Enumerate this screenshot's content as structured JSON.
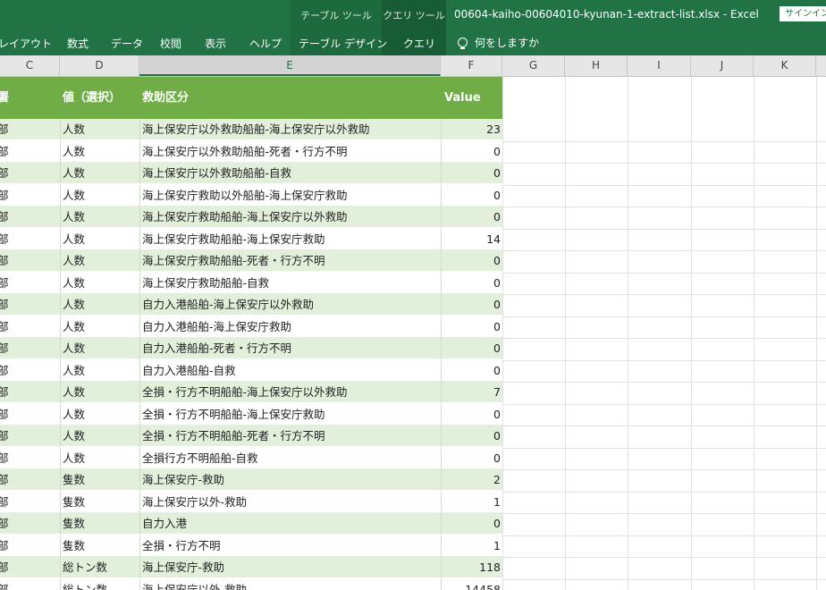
{
  "ribbon": {
    "context_table": "テーブル ツール",
    "context_query": "クエリ ツール",
    "file_title": "00604-kaiho-00604010-kyunan-1-extract-list.xlsx  -  Excel",
    "signin": "サインイン",
    "tabs": [
      "レイアウト",
      "数式",
      "データ",
      "校閲",
      "表示",
      "ヘルプ",
      "テーブル デザイン",
      "クエリ"
    ],
    "tell_me": "何をしますか"
  },
  "columns": [
    "C",
    "D",
    "E",
    "F",
    "G",
    "H",
    "I",
    "J",
    "K"
  ],
  "table": {
    "headers": [
      "署",
      "値（選択）",
      "救助区分",
      "Value"
    ],
    "rows": [
      {
        "c": "部",
        "d": "人数",
        "e": "海上保安庁以外救助船舶-海上保安庁以外救助",
        "f": "23"
      },
      {
        "c": "部",
        "d": "人数",
        "e": "海上保安庁以外救助船舶-死者・行方不明",
        "f": "0"
      },
      {
        "c": "部",
        "d": "人数",
        "e": "海上保安庁以外救助船舶-自救",
        "f": "0"
      },
      {
        "c": "部",
        "d": "人数",
        "e": "海上保安庁救助以外船舶-海上保安庁救助",
        "f": "0"
      },
      {
        "c": "部",
        "d": "人数",
        "e": "海上保安庁救助船舶-海上保安庁以外救助",
        "f": "0"
      },
      {
        "c": "部",
        "d": "人数",
        "e": "海上保安庁救助船舶-海上保安庁救助",
        "f": "14"
      },
      {
        "c": "部",
        "d": "人数",
        "e": "海上保安庁救助船舶-死者・行方不明",
        "f": "0"
      },
      {
        "c": "部",
        "d": "人数",
        "e": "海上保安庁救助船舶-自救",
        "f": "0"
      },
      {
        "c": "部",
        "d": "人数",
        "e": "自力入港船舶-海上保安庁以外救助",
        "f": "0"
      },
      {
        "c": "部",
        "d": "人数",
        "e": "自力入港船舶-海上保安庁救助",
        "f": "0"
      },
      {
        "c": "部",
        "d": "人数",
        "e": "自力入港船舶-死者・行方不明",
        "f": "0"
      },
      {
        "c": "部",
        "d": "人数",
        "e": "自力入港船舶-自救",
        "f": "0"
      },
      {
        "c": "部",
        "d": "人数",
        "e": "全損・行方不明船舶-海上保安庁以外救助",
        "f": "7"
      },
      {
        "c": "部",
        "d": "人数",
        "e": "全損・行方不明船舶-海上保安庁救助",
        "f": "0"
      },
      {
        "c": "部",
        "d": "人数",
        "e": "全損・行方不明船舶-死者・行方不明",
        "f": "0"
      },
      {
        "c": "部",
        "d": "人数",
        "e": "全損行方不明船舶-自救",
        "f": "0"
      },
      {
        "c": "部",
        "d": "隻数",
        "e": "海上保安庁-救助",
        "f": "2"
      },
      {
        "c": "部",
        "d": "隻数",
        "e": "海上保安庁以外-救助",
        "f": "1"
      },
      {
        "c": "部",
        "d": "隻数",
        "e": "自力入港",
        "f": "0"
      },
      {
        "c": "部",
        "d": "隻数",
        "e": "全損・行方不明",
        "f": "1"
      },
      {
        "c": "部",
        "d": "総トン数",
        "e": "海上保安庁-救助",
        "f": "118"
      },
      {
        "c": "部",
        "d": "総トン数",
        "e": "海上保安庁以外-救助",
        "f": "14458"
      }
    ]
  }
}
